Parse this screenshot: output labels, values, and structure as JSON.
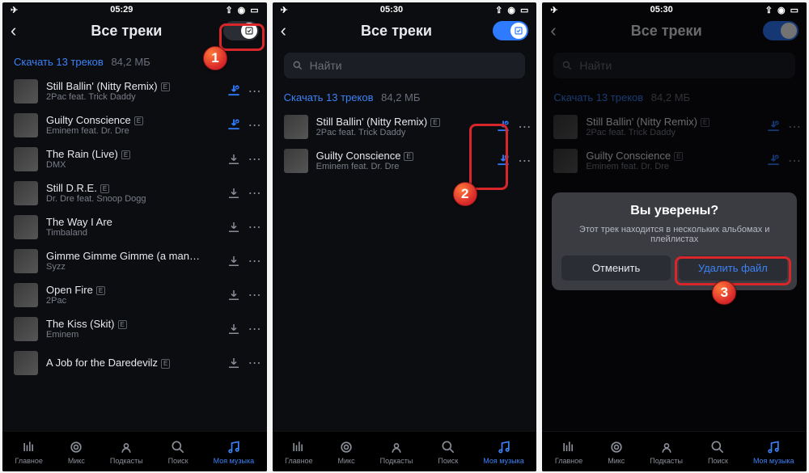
{
  "status": {
    "time1": "05:29",
    "time2": "05:30",
    "plane": "✈",
    "sig": "📶",
    "batt": "🔋"
  },
  "header": {
    "title": "Все треки"
  },
  "download": {
    "label": "Скачать 13 треков",
    "size": "84,2 МБ"
  },
  "search": {
    "placeholder": "Найти"
  },
  "tracks_full": [
    {
      "name": "Still Ballin' (Nitty Remix)",
      "artist": "2Pac feat. Trick Daddy",
      "explicit": true,
      "saved": true
    },
    {
      "name": "Guilty Conscience",
      "artist": "Eminem feat. Dr. Dre",
      "explicit": true,
      "saved": true
    },
    {
      "name": "The Rain (Live)",
      "artist": "DMX",
      "explicit": true,
      "saved": false
    },
    {
      "name": "Still D.R.E.",
      "artist": "Dr. Dre feat. Snoop Dogg",
      "explicit": true,
      "saved": false
    },
    {
      "name": "The Way I Are",
      "artist": "Timbaland",
      "explicit": false,
      "saved": false
    },
    {
      "name": "Gimme Gimme Gimme (a man…",
      "artist": "Syzz",
      "explicit": false,
      "saved": false
    },
    {
      "name": "Open Fire",
      "artist": "2Pac",
      "explicit": true,
      "saved": false
    },
    {
      "name": "The Kiss (Skit)",
      "artist": "Eminem",
      "explicit": true,
      "saved": false
    },
    {
      "name": "A Job for the Daredevilz",
      "artist": "",
      "explicit": true,
      "saved": false
    }
  ],
  "tracks_filtered": [
    {
      "name": "Still Ballin' (Nitty Remix)",
      "artist": "2Pac feat. Trick Daddy",
      "explicit": true
    },
    {
      "name": "Guilty Conscience",
      "artist": "Eminem feat. Dr. Dre",
      "explicit": true
    }
  ],
  "nav": [
    {
      "label": "Главное",
      "icon": "bars"
    },
    {
      "label": "Микс",
      "icon": "mix"
    },
    {
      "label": "Подкасты",
      "icon": "podcast"
    },
    {
      "label": "Поиск",
      "icon": "search"
    },
    {
      "label": "Моя музыка",
      "icon": "music"
    }
  ],
  "dialog": {
    "title": "Вы уверены?",
    "body": "Этот трек находится в нескольких альбомах и плейлистах",
    "cancel": "Отменить",
    "delete": "Удалить файл"
  },
  "annotations": {
    "b1": "1",
    "b2": "2",
    "b3": "3"
  }
}
